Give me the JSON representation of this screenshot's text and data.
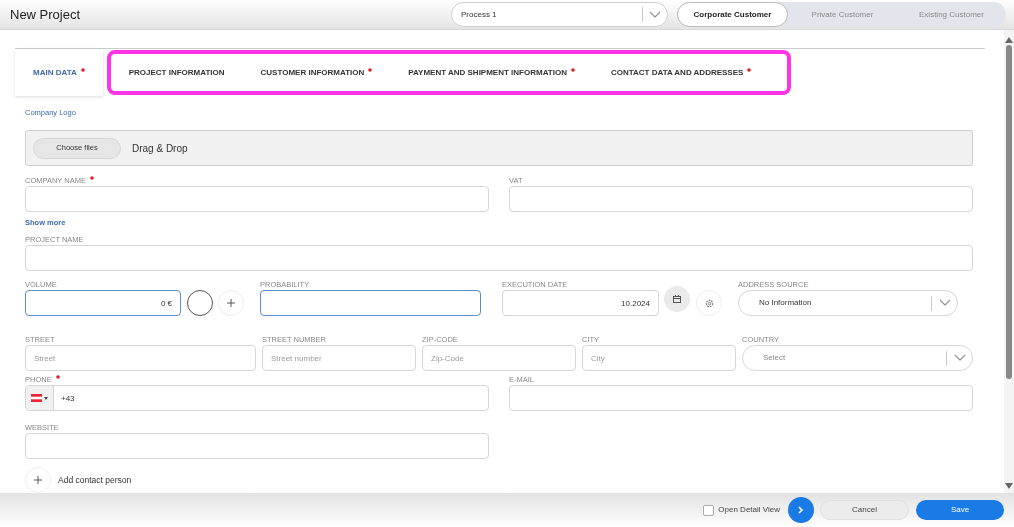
{
  "header": {
    "title": "New Project"
  },
  "process_select": {
    "value": "Process 1"
  },
  "customer_types": [
    {
      "label": "Corporate Customer",
      "selected": true
    },
    {
      "label": "Private Customer",
      "selected": false
    },
    {
      "label": "Existing Customer",
      "selected": false
    }
  ],
  "tabs": [
    {
      "label": "MAIN DATA",
      "required": true,
      "selected": true,
      "highlighted": false
    },
    {
      "label": "PROJECT INFORMATION",
      "required": false,
      "selected": false,
      "highlighted": true
    },
    {
      "label": "CUSTOMER INFORMATION",
      "required": true,
      "selected": false,
      "highlighted": true
    },
    {
      "label": "PAYMENT AND SHIPMENT INFORMATION",
      "required": true,
      "selected": false,
      "highlighted": true
    },
    {
      "label": "CONTACT DATA AND ADDRESSES",
      "required": true,
      "selected": false,
      "highlighted": true
    }
  ],
  "company_logo": {
    "label": "Company Logo",
    "button": "Choose files",
    "hint": "Drag & Drop"
  },
  "fields": {
    "company_name": {
      "label": "COMPANY NAME",
      "required": true,
      "focused": false
    },
    "vat": {
      "label": "VAT",
      "focused": false
    },
    "project_name": {
      "label": "PROJECT NAME",
      "focused": false
    },
    "volume": {
      "label": "VOLUME",
      "focused": true,
      "value": "0 €"
    },
    "probability": {
      "label": "PROBABILITY",
      "focused": true
    },
    "execution_date": {
      "label": "EXECUTION DATE",
      "focused": false,
      "value": "10.2024"
    },
    "address_source": {
      "label": "ADDRESS SOURCE",
      "focused": false,
      "value": "No Information"
    },
    "street": {
      "label": "STREET",
      "focused": false,
      "placeholder": "Street"
    },
    "street_number": {
      "label": "STREET NUMBER",
      "focused": false,
      "placeholder": "Street number"
    },
    "zip_code": {
      "label": "ZIP-CODE",
      "focused": false,
      "placeholder": "Zip-Code"
    },
    "city": {
      "label": "CITY",
      "focused": false,
      "placeholder": "City"
    },
    "country": {
      "label": "COUNTRY",
      "focused": false,
      "placeholder": "Select"
    },
    "phone": {
      "label": "PHONE",
      "required": true,
      "focused": false,
      "value": "+43"
    },
    "email": {
      "label": "E-MAIL",
      "focused": false
    },
    "website": {
      "label": "WEBSITE",
      "focused": false
    }
  },
  "show_more": "Show more",
  "add_contact": {
    "label": "Add contact person"
  },
  "footer": {
    "detail_view": {
      "label": "Open Detail View",
      "checked": false
    },
    "cancel": "Cancel",
    "save": "Save"
  }
}
